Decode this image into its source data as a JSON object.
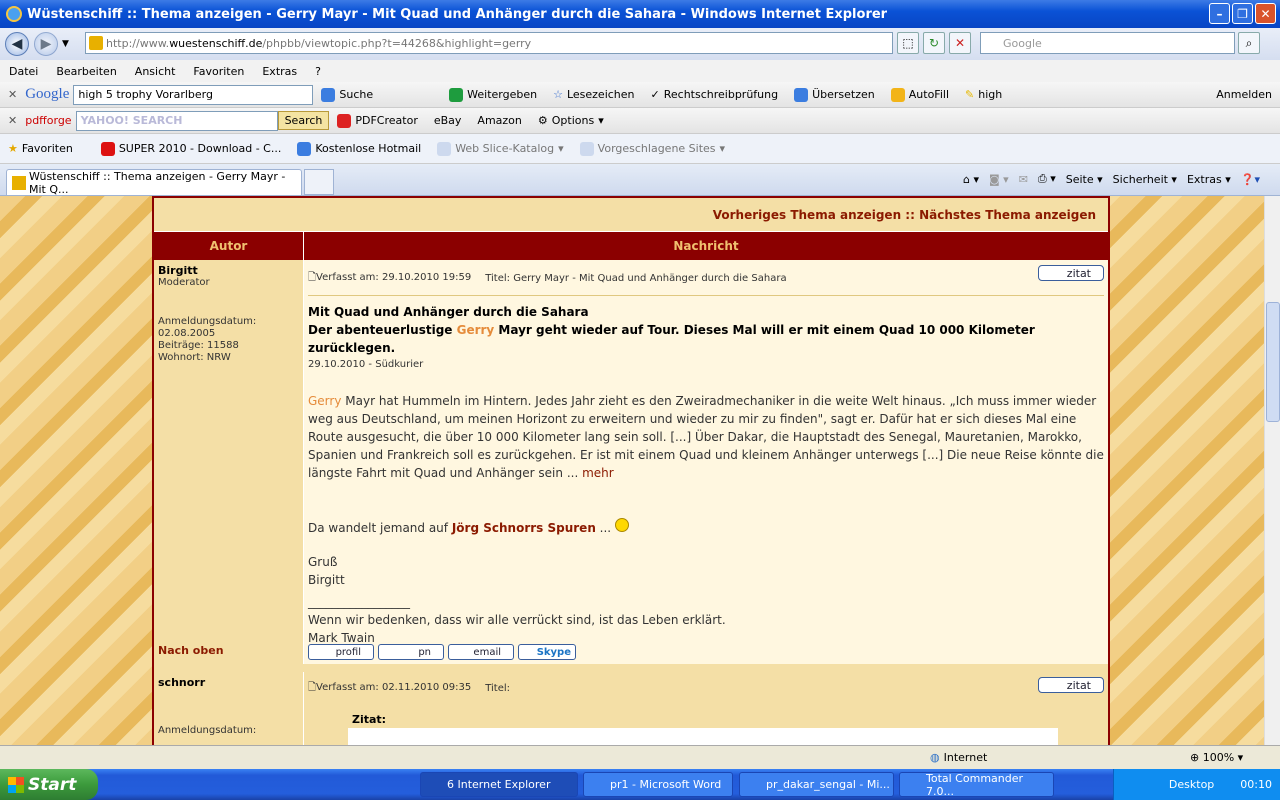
{
  "window": {
    "title": "Wüstenschiff :: Thema anzeigen - Gerry Mayr - Mit Quad und Anhänger durch die Sahara - Windows Internet Explorer"
  },
  "address": {
    "prefix": "http://www.",
    "domain": "wuestenschiff.de",
    "path": "/phpbb/viewtopic.php?t=44268&highlight=gerry",
    "search_placeholder": "Google"
  },
  "menu": [
    "Datei",
    "Bearbeiten",
    "Ansicht",
    "Favoriten",
    "Extras",
    "?"
  ],
  "google_bar": {
    "logo": "Google",
    "query": "high 5 trophy Vorarlberg",
    "items": [
      "Suche",
      "Weitergeben",
      "Lesezeichen",
      "Rechtschreibprüfung",
      "Übersetzen",
      "AutoFill",
      "high",
      "Anmelden"
    ]
  },
  "pdf_bar": {
    "logo": "pdfforge",
    "search_hint": "YAHOO! SEARCH",
    "search_btn": "Search",
    "items": [
      "PDFCreator",
      "eBay",
      "Amazon",
      "Options"
    ]
  },
  "favorites_bar": {
    "label": "Favoriten",
    "items": [
      "SUPER 2010 - Download - C...",
      "Kostenlose Hotmail",
      "Web Slice-Katalog",
      "Vorgeschlagene Sites"
    ]
  },
  "tab": {
    "title": "Wüstenschiff :: Thema anzeigen - Gerry Mayr - Mit Q...",
    "cmd": [
      "Seite",
      "Sicherheit",
      "Extras"
    ]
  },
  "forum": {
    "nav": "Vorheriges Thema anzeigen :: Nächstes Thema anzeigen",
    "col_author": "Autor",
    "col_message": "Nachricht",
    "post1": {
      "author": "Birgitt",
      "role": "Moderator",
      "reg_label": "Anmeldungsdatum:",
      "reg_date": "02.08.2005",
      "posts": "Beiträge: 11588",
      "location": "Wohnort: NRW",
      "posted": "Verfasst am: 29.10.2010 19:59",
      "title": "Titel: Gerry Mayr - Mit Quad und Anhänger durch die Sahara",
      "quote_btn": "zitat",
      "headline": "Mit Quad und Anhänger durch die Sahara",
      "sub_a": "Der abenteuerlustige ",
      "sub_hl": "Gerry",
      "sub_b": " Mayr geht wieder auf Tour. Dieses Mal will er mit einem Quad 10 000 Kilometer zurücklegen.",
      "source": "29.10.2010 - Südkurier",
      "body_hl": "Gerry",
      "body": " Mayr hat Hummeln im Hintern. Jedes Jahr zieht es den Zweiradmechaniker in die weite Welt hinaus. „Ich muss immer wieder weg aus Deutschland, um meinen Horizont zu erweitern und wieder zu mir zu finden\", sagt er. Dafür hat er sich dieses Mal eine Route ausgesucht, die über 10 000 Kilometer lang sein soll. [...] Über Dakar, die Hauptstadt des Senegal, Mauretanien, Marokko, Spanien und Frankreich soll es zurückgehen. Er ist mit einem Quad und kleinem Anhänger unterwegs [...] Die neue Reise könnte die längste Fahrt mit Quad und Anhänger sein ... ",
      "more": "mehr",
      "line_a": "Da wandelt jemand auf ",
      "line_link": "Jörg Schnorrs Spuren",
      "line_b": " ...",
      "greet": "Gruß",
      "sig_name": "Birgitt",
      "sig_line": "_________________",
      "quote_text": "Wenn wir bedenken, dass wir alle verrückt sind, ist das Leben erklärt.",
      "quote_author": "Mark Twain",
      "top_link": "Nach oben",
      "buttons": [
        "profil",
        "pn",
        "email",
        "Skype"
      ]
    },
    "post2": {
      "author": "schnorr",
      "reg_label": "Anmeldungsdatum:",
      "posted": "Verfasst am: 02.11.2010 09:35",
      "title": "Titel:",
      "quote_btn": "zitat",
      "zitat_label": "Zitat:"
    }
  },
  "status": {
    "zone": "Internet",
    "zoom": "100%"
  },
  "taskbar": {
    "start": "Start",
    "items": [
      "6 Internet Explorer",
      "pr1 - Microsoft Word",
      "pr_dakar_sengal - Mi...",
      "Total Commander 7.0..."
    ],
    "desktop": "Desktop",
    "time": "00:10"
  }
}
